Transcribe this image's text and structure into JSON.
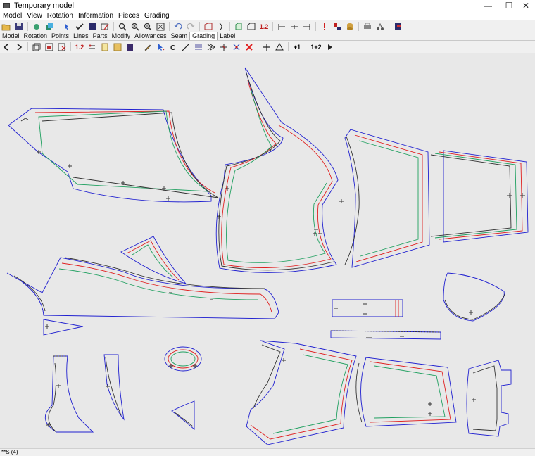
{
  "window": {
    "title": "Temporary model"
  },
  "window_controls": {
    "minimize": "—",
    "maximize": "☐",
    "close": "✕"
  },
  "menu": [
    "Model",
    "View",
    "Rotation",
    "Information",
    "Pieces",
    "Grading"
  ],
  "tabs": [
    {
      "label": "Model",
      "active": false
    },
    {
      "label": "Rotation",
      "active": false
    },
    {
      "label": "Points",
      "active": false
    },
    {
      "label": "Lines",
      "active": false
    },
    {
      "label": "Parts",
      "active": false
    },
    {
      "label": "Modify",
      "active": false
    },
    {
      "label": "Allowances",
      "active": false
    },
    {
      "label": "Seam",
      "active": false
    },
    {
      "label": "Grading",
      "active": true
    },
    {
      "label": "Label",
      "active": false
    }
  ],
  "toolbar_text": {
    "size_range": "1.2",
    "plus_one": "+1",
    "one_plus_two": "1+2"
  },
  "colors": {
    "base_size": "#2020d0",
    "size_red": "#e02020",
    "size_green": "#20a060",
    "size_dark": "#333333"
  },
  "status": {
    "text": "**S (4)"
  }
}
